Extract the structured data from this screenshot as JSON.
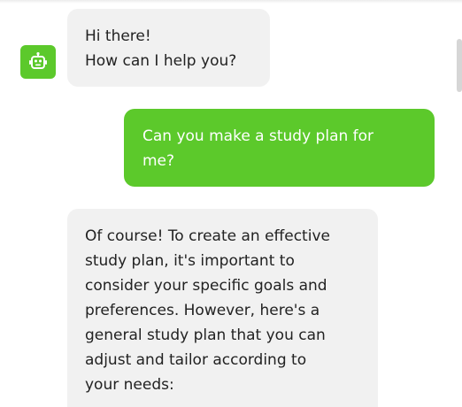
{
  "colors": {
    "bot_avatar": "#5cc92b",
    "user_bubble": "#5cc92b",
    "bot_bubble": "#f1f1f1"
  },
  "bot_avatar_icon": "robot-icon",
  "messages": [
    {
      "sender": "bot",
      "lines": [
        "Hi there!",
        "How can I help you?"
      ]
    },
    {
      "sender": "user",
      "lines": [
        "Can you make a study plan for",
        "me?"
      ]
    },
    {
      "sender": "bot",
      "lines": [
        "Of course! To create an effective",
        "study plan, it's important to",
        "consider your specific goals and",
        "preferences. However, here's a",
        "general study plan that you can",
        "adjust and tailor according to",
        "your needs:"
      ]
    }
  ]
}
